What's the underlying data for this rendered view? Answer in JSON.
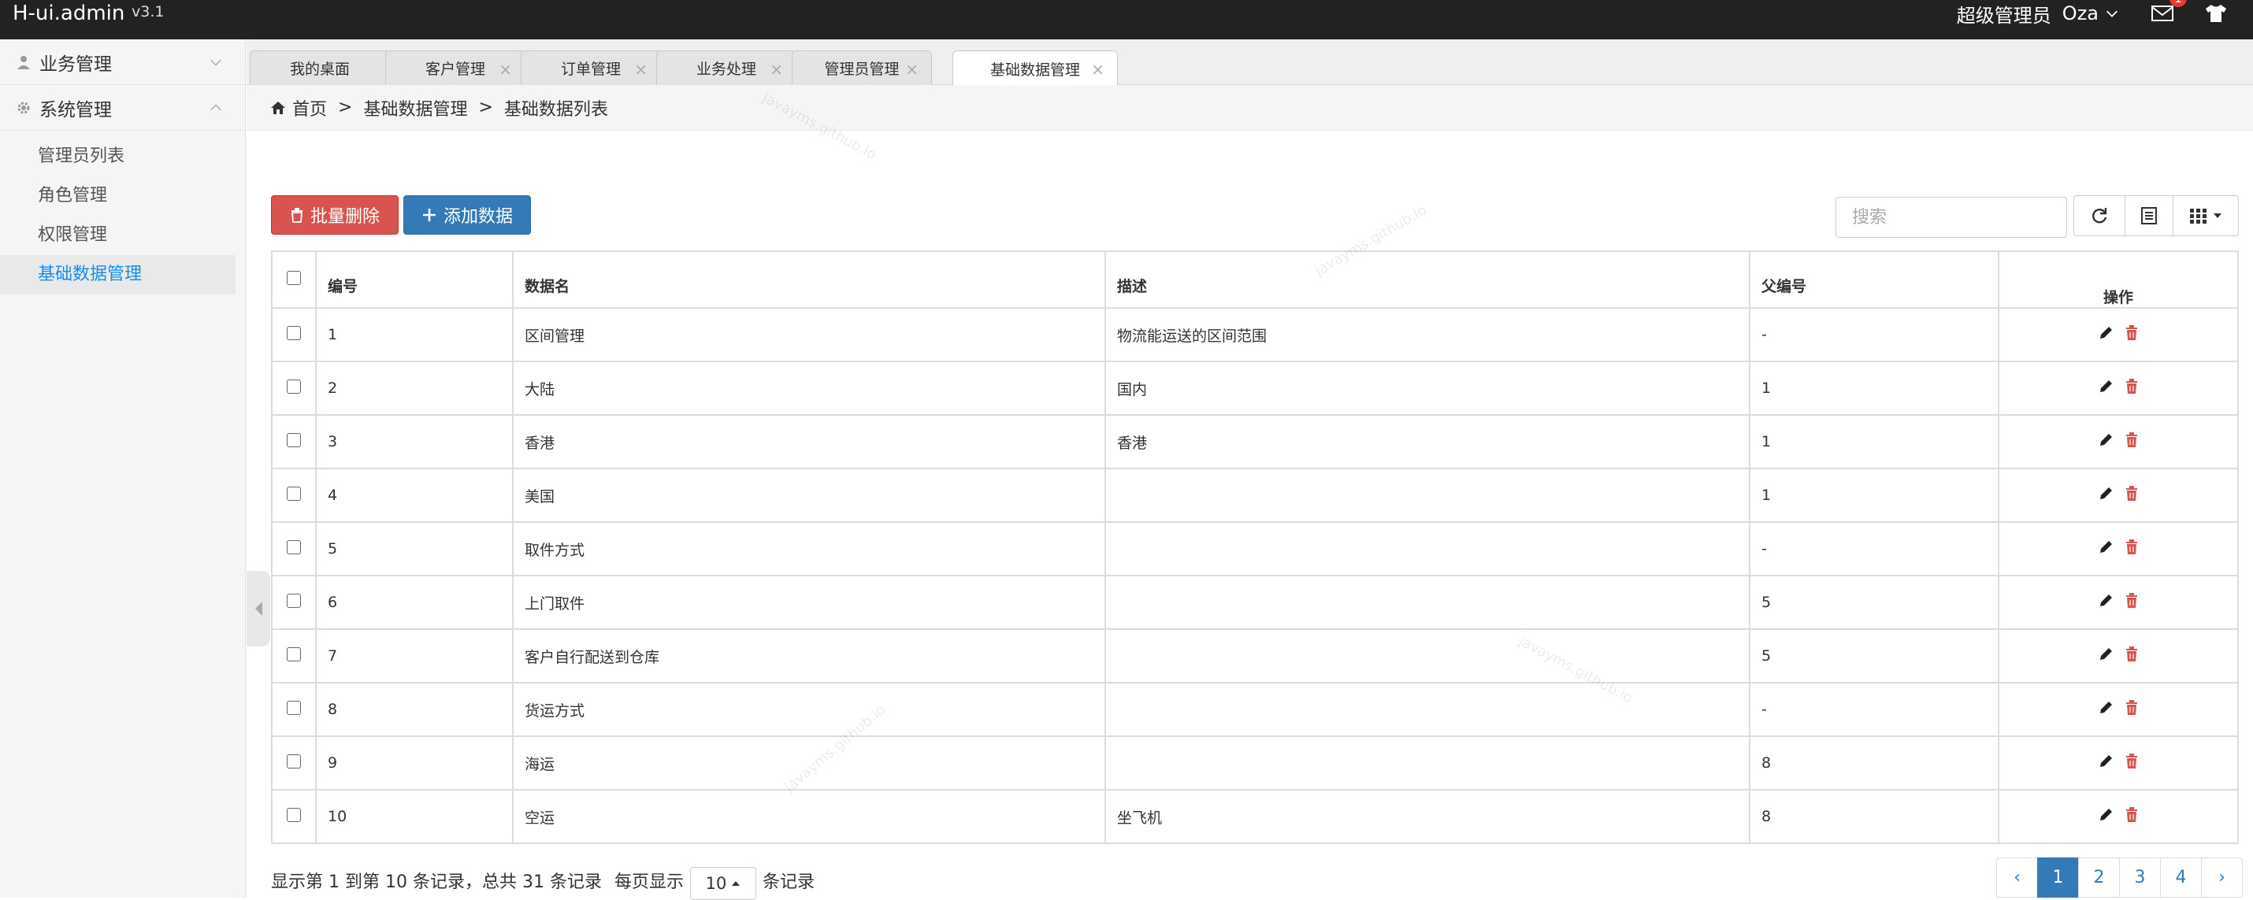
{
  "app": {
    "logo": "H-ui.admin",
    "version": "v3.1"
  },
  "header": {
    "role": "超级管理员",
    "user": "Oza",
    "mail_badge": "1"
  },
  "sidebar": {
    "groups": [
      {
        "label": "业务管理",
        "expanded": false
      },
      {
        "label": "系统管理",
        "expanded": true
      }
    ],
    "items": [
      "管理员列表",
      "角色管理",
      "权限管理",
      "基础数据管理"
    ],
    "active_item": "基础数据管理"
  },
  "tabs": [
    {
      "label": "我的桌面",
      "closable": false
    },
    {
      "label": "客户管理",
      "closable": true
    },
    {
      "label": "订单管理",
      "closable": true
    },
    {
      "label": "业务处理",
      "closable": true
    },
    {
      "label": "管理员管理",
      "closable": true
    },
    {
      "label": "基础数据管理",
      "closable": true,
      "active": true
    }
  ],
  "breadcrumb": {
    "home": "首页",
    "sep": ">",
    "level1": "基础数据管理",
    "level2": "基础数据列表"
  },
  "toolbar": {
    "batch_delete": "批量删除",
    "add_data": "添加数据",
    "search_placeholder": "搜索"
  },
  "table": {
    "headers": [
      "编号",
      "数据名",
      "描述",
      "父编号",
      "操作"
    ],
    "rows": [
      {
        "id": "1",
        "name": "区间管理",
        "desc": "物流能运送的区间范围",
        "parent": "-"
      },
      {
        "id": "2",
        "name": "大陆",
        "desc": "国内",
        "parent": "1"
      },
      {
        "id": "3",
        "name": "香港",
        "desc": "香港",
        "parent": "1"
      },
      {
        "id": "4",
        "name": "美国",
        "desc": "",
        "parent": "1"
      },
      {
        "id": "5",
        "name": "取件方式",
        "desc": "",
        "parent": "-"
      },
      {
        "id": "6",
        "name": "上门取件",
        "desc": "",
        "parent": "5"
      },
      {
        "id": "7",
        "name": "客户自行配送到仓库",
        "desc": "",
        "parent": "5"
      },
      {
        "id": "8",
        "name": "货运方式",
        "desc": "",
        "parent": "-"
      },
      {
        "id": "9",
        "name": "海运",
        "desc": "",
        "parent": "8"
      },
      {
        "id": "10",
        "name": "空运",
        "desc": "坐飞机",
        "parent": "8"
      }
    ]
  },
  "footer": {
    "summary": "显示第 1 到第 10 条记录，总共 31 条记录",
    "per_page_prefix": "每页显示",
    "per_page": "10",
    "per_page_suffix": "条记录"
  },
  "pagination": {
    "prev": "‹",
    "pages": [
      "1",
      "2",
      "3",
      "4"
    ],
    "current": "1",
    "next": "›"
  },
  "watermark": "javayms.github.io",
  "colors": {
    "topbar": "#222222",
    "danger": "#d9534f",
    "primary": "#337ab7",
    "active_link": "#148cf1"
  }
}
